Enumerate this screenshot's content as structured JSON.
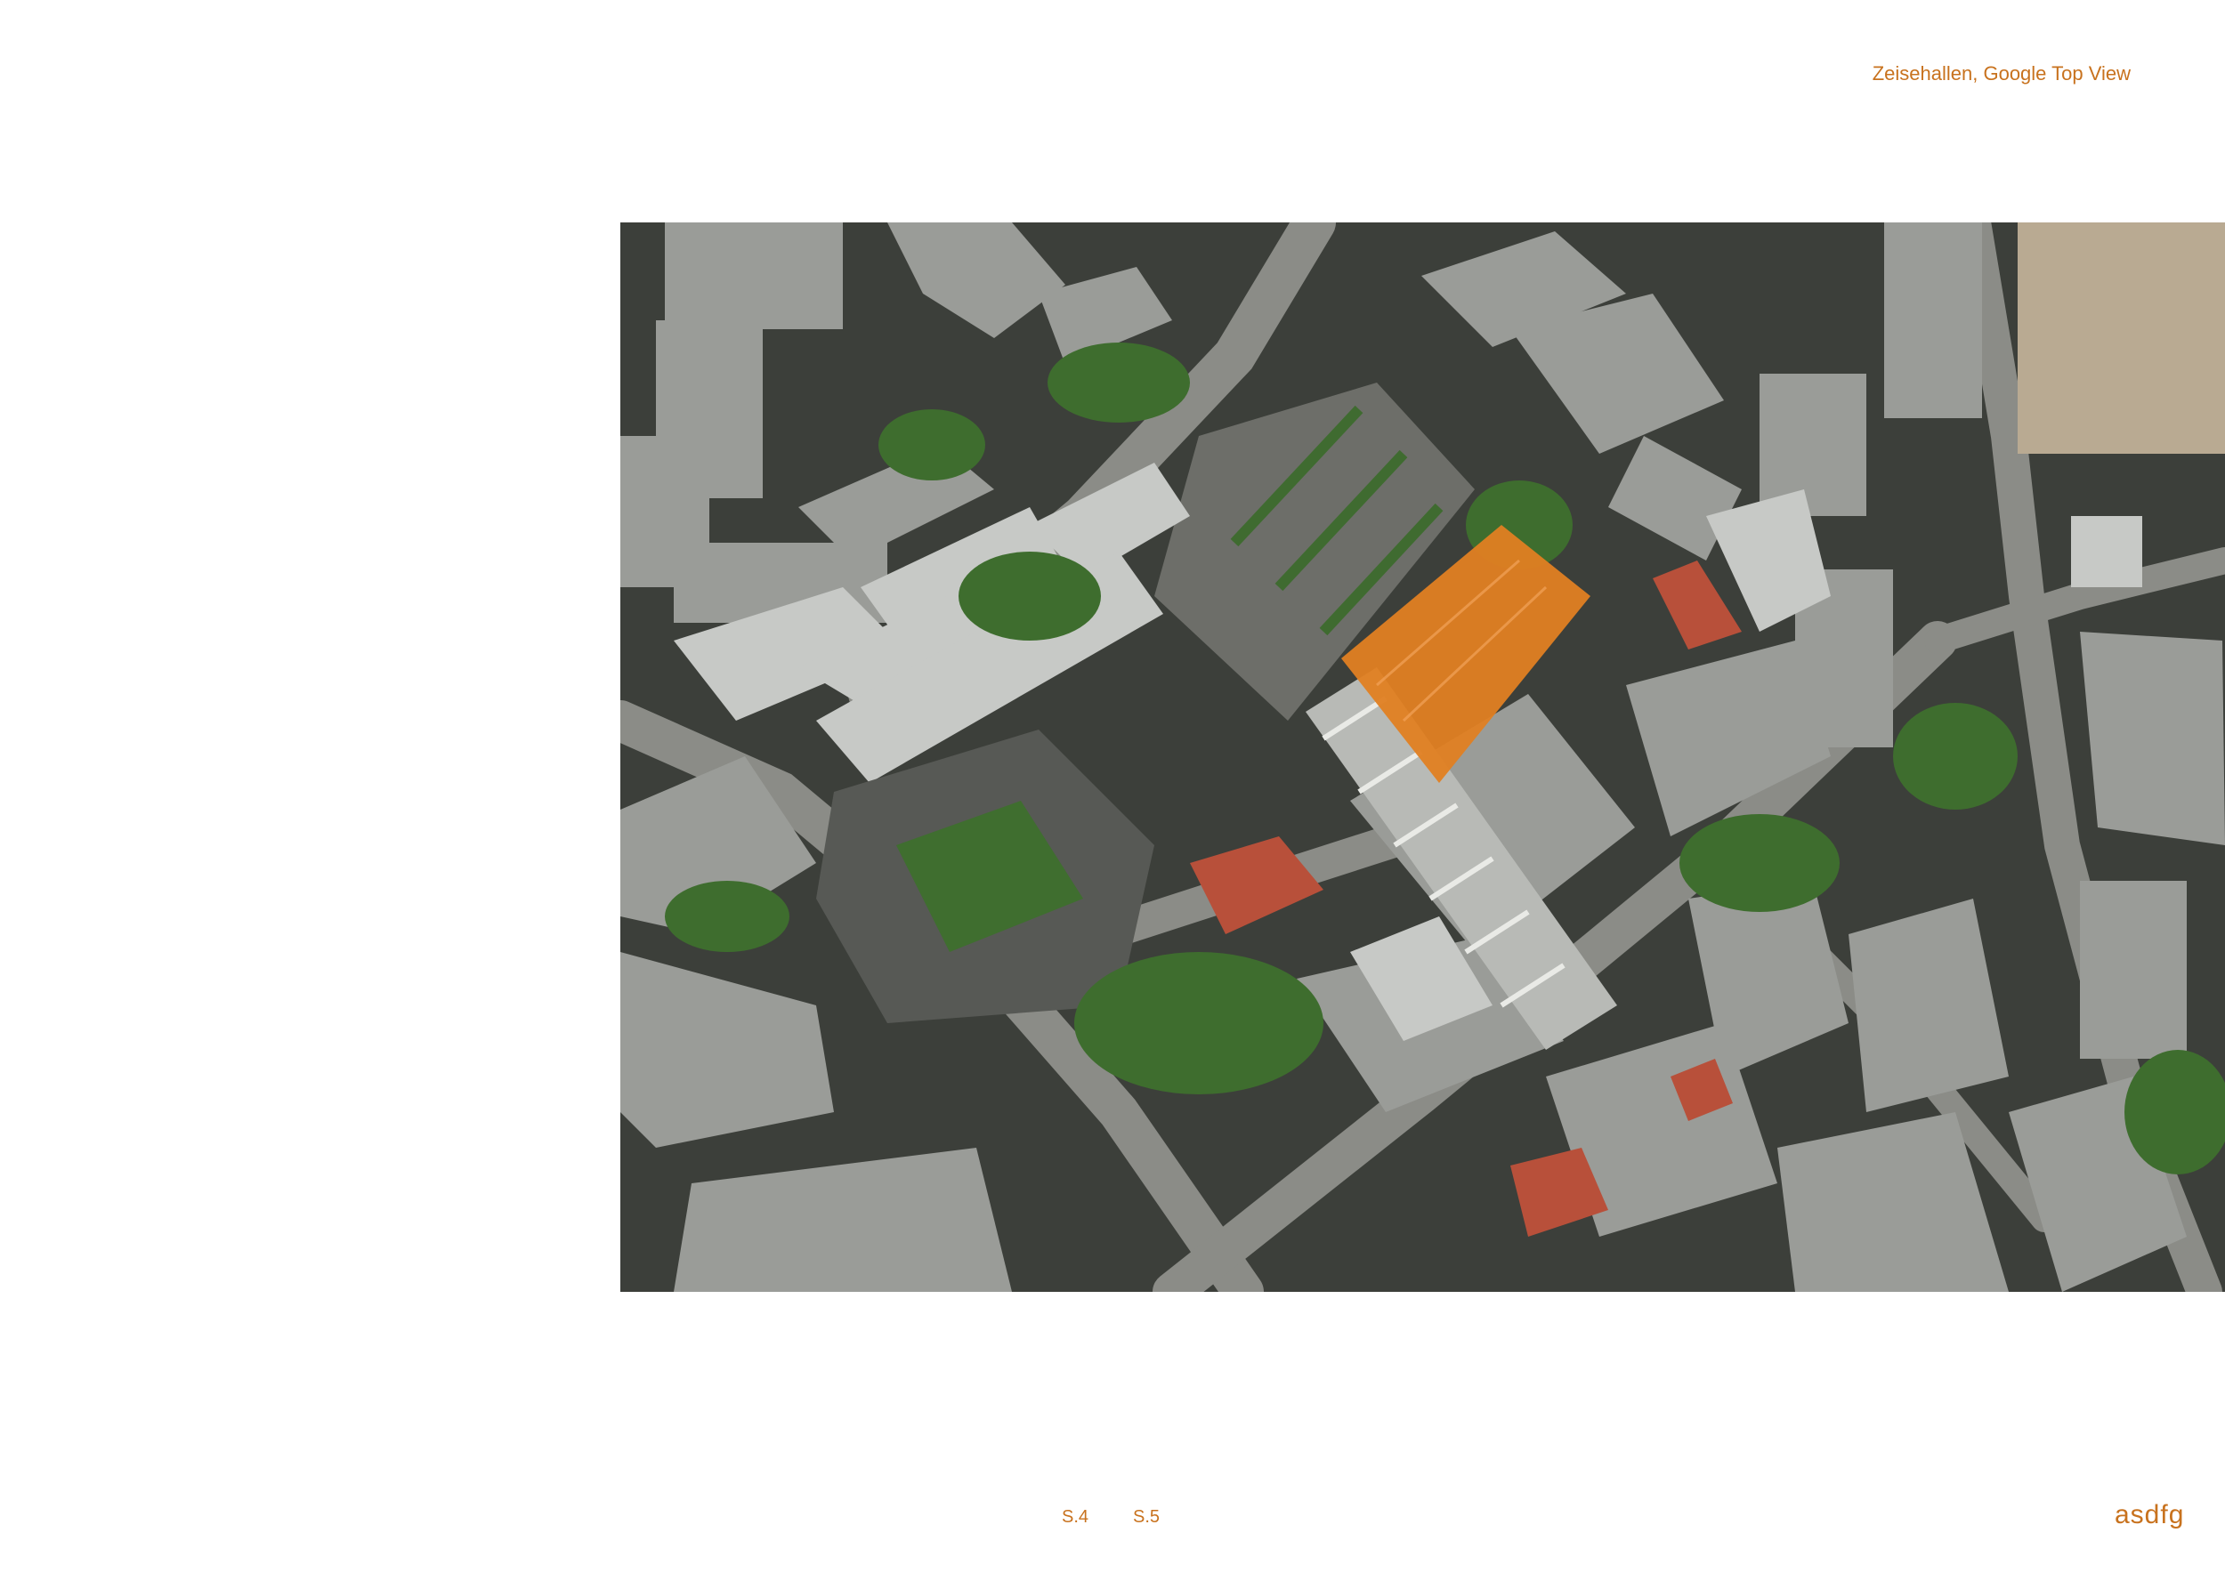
{
  "caption": "Zeisehallen, Google Top View",
  "pages": [
    "S.4",
    "S.5"
  ],
  "logo": "asdfg",
  "colors": {
    "accent": "#c8721e",
    "highlight_building": "#e07f22",
    "neighbor_roof": "#b8503a"
  }
}
